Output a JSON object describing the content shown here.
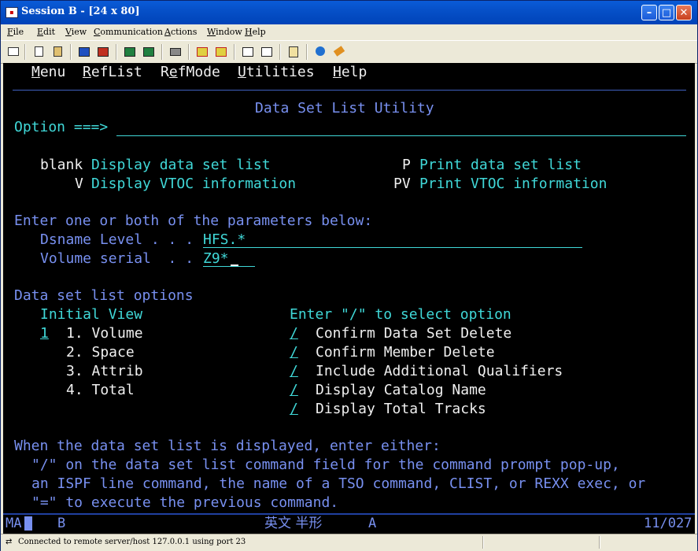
{
  "window": {
    "title": "Session B - [24 x 80]"
  },
  "menubar": {
    "items": [
      "File",
      "Edit",
      "View",
      "Communication",
      "Actions",
      "Window",
      "Help"
    ]
  },
  "toolbar": {
    "icons": [
      "print-screen-icon",
      "copy-icon",
      "paste-icon",
      "send-icon",
      "receive-icon",
      "display-icon",
      "color-map-icon",
      "keyboard-map-icon",
      "quick-macro-icon",
      "macro-play-icon",
      "record-macro-icon",
      "stop-macro-icon",
      "clipboard-icon",
      "help-icon",
      "support-icon"
    ]
  },
  "terminal": {
    "action_bar": [
      "Menu",
      "RefList",
      "RefMode",
      "Utilities",
      "Help"
    ],
    "panel_title": "Data Set List Utility",
    "option_prompt": "Option ===>",
    "actions": {
      "blank_key": "blank",
      "blank_desc": "Display data set list",
      "v_key": "V",
      "v_desc": "Display VTOC information",
      "p_key": "P",
      "p_desc": "Print data set list",
      "pv_key": "PV",
      "pv_desc": "Print VTOC information"
    },
    "params_header": "Enter one or both of the parameters below:",
    "dsname_label": "Dsname Level . . .",
    "dsname_value": "HFS.*",
    "volume_label": "Volume serial  . .",
    "volume_value": "Z9*",
    "options_header": "Data set list options",
    "initial_view_label": "Initial View",
    "initial_view_value": "1",
    "views": [
      "1. Volume",
      "2. Space",
      "3. Attrib",
      "4. Total"
    ],
    "select_label": "Enter \"/\" to select option",
    "select_options": [
      {
        "mark": "/",
        "label": "Confirm Data Set Delete"
      },
      {
        "mark": "/",
        "label": "Confirm Member Delete"
      },
      {
        "mark": "/",
        "label": "Include Additional Qualifiers"
      },
      {
        "mark": "/",
        "label": "Display Catalog Name"
      },
      {
        "mark": "/",
        "label": "Display Total Tracks"
      }
    ],
    "help_1": "When the data set list is displayed, enter either:",
    "help_2": "\"/\" on the data set list command field for the command prompt pop-up,",
    "help_3": "an ISPF line command, the name of a TSO command, CLIST, or REXX exec, or",
    "help_4": "\"=\" to execute the previous command."
  },
  "oia": {
    "ma": "MA",
    "session": "B",
    "ime": "英文 半形",
    "mode": "A",
    "cursor": "11/027"
  },
  "status": {
    "text": "Connected to remote server/host 127.0.0.1 using port 23"
  },
  "colors": {
    "field_label": "#7890f0",
    "field_value": "#40d8d8",
    "emphasis": "#f0f0f0",
    "background": "#000000"
  }
}
